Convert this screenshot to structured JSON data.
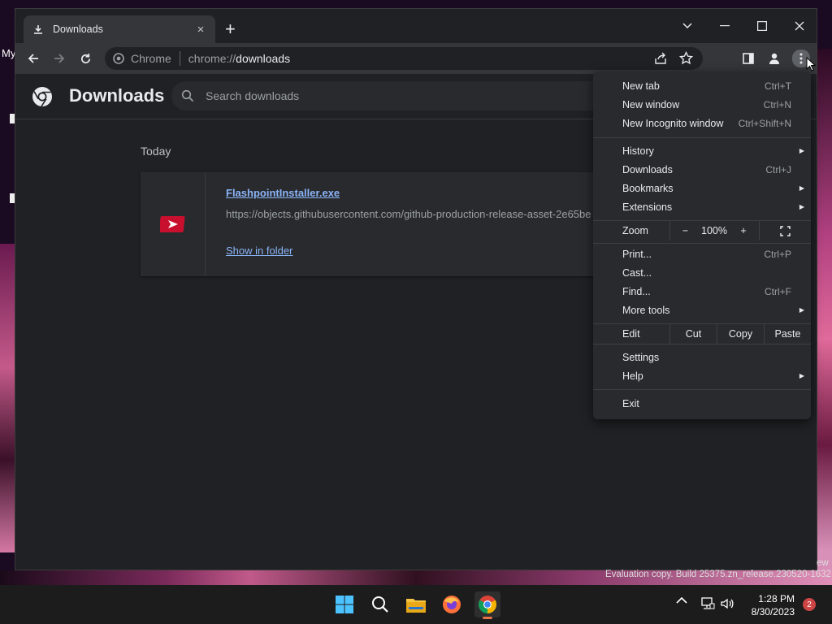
{
  "desktop": {
    "left_text": "My"
  },
  "tab": {
    "title": "Downloads",
    "close": "×"
  },
  "newtab": "+",
  "omnibox": {
    "chip": "Chrome",
    "scheme": "chrome://",
    "host": "downloads"
  },
  "page": {
    "title": "Downloads",
    "search_placeholder": "Search downloads",
    "date_header": "Today",
    "item": {
      "filename": "FlashpointInstaller.exe",
      "url": "https://objects.githubusercontent.com/github-production-release-asset-2e65be",
      "action": "Show in folder"
    }
  },
  "menu": {
    "new_tab": {
      "label": "New tab",
      "shortcut": "Ctrl+T"
    },
    "new_window": {
      "label": "New window",
      "shortcut": "Ctrl+N"
    },
    "incognito": {
      "label": "New Incognito window",
      "shortcut": "Ctrl+Shift+N"
    },
    "history": {
      "label": "History"
    },
    "downloads": {
      "label": "Downloads",
      "shortcut": "Ctrl+J"
    },
    "bookmarks": {
      "label": "Bookmarks"
    },
    "extensions": {
      "label": "Extensions"
    },
    "zoom": {
      "label": "Zoom",
      "minus": "−",
      "value": "100%",
      "plus": "+"
    },
    "print": {
      "label": "Print...",
      "shortcut": "Ctrl+P"
    },
    "cast": {
      "label": "Cast..."
    },
    "find": {
      "label": "Find...",
      "shortcut": "Ctrl+F"
    },
    "more_tools": {
      "label": "More tools"
    },
    "edit": {
      "label": "Edit",
      "cut": "Cut",
      "copy": "Copy",
      "paste": "Paste"
    },
    "settings": {
      "label": "Settings"
    },
    "help": {
      "label": "Help"
    },
    "exit": {
      "label": "Exit"
    }
  },
  "watermark": {
    "eval": "Evaluation copy. Build 25375.zn_release.230520-1632",
    "ew": "ew"
  },
  "clock": {
    "time": "1:28 PM",
    "date": "8/30/2023"
  },
  "notifications": {
    "count": "2"
  },
  "colors": {
    "accent": "#8ab4f8",
    "bg": "#202124",
    "menu": "#292a2d"
  }
}
